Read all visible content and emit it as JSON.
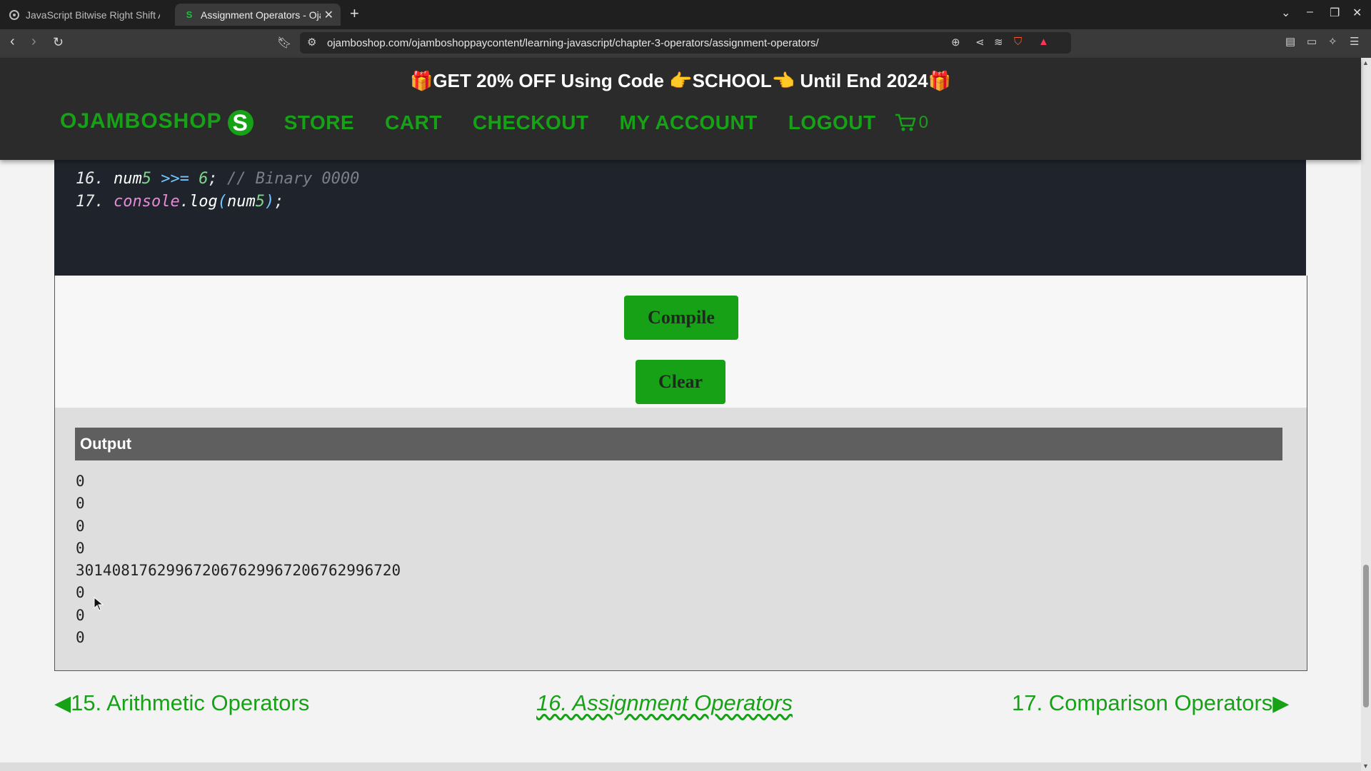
{
  "browser": {
    "tabs": [
      {
        "title": "JavaScript Bitwise Right Shift Assignment",
        "icon": "ojamboshop-favicon"
      },
      {
        "title": "Assignment Operators - Ojambo Shop",
        "icon": "ojamboshop-s-favicon",
        "active": true
      }
    ],
    "url": "ojamboshop.com/ojamboshoppaycontent/learning-javascript/chapter-3-operators/assignment-operators/"
  },
  "header": {
    "promo": "🎁GET 20% OFF Using Code 👉SCHOOL👈 Until End 2024🎁",
    "logo_text": "OJAMBOSHOP",
    "logo_letter": "S",
    "nav": [
      "STORE",
      "CART",
      "CHECKOUT",
      "MY ACCOUNT",
      "LOGOUT"
    ],
    "cart_count": "0"
  },
  "editor": {
    "lines": [
      {
        "num": "16.",
        "tokens": [
          [
            "num",
            "k-var"
          ],
          [
            "5",
            "k-digit"
          ],
          [
            " ",
            ""
          ],
          [
            ">>=",
            "k-op"
          ],
          [
            " ",
            ""
          ],
          [
            "6",
            "k-digit"
          ],
          [
            "; ",
            ""
          ],
          [
            "// Binary 0000",
            "k-comment"
          ]
        ]
      },
      {
        "num": "17.",
        "tokens": [
          [
            "console",
            "k-fn"
          ],
          [
            ".",
            ""
          ],
          [
            "log",
            "k-var"
          ],
          [
            "(",
            "k-op"
          ],
          [
            "num",
            "k-var"
          ],
          [
            "5",
            "k-digit"
          ],
          [
            ")",
            "k-op"
          ],
          [
            ";",
            ""
          ]
        ]
      }
    ]
  },
  "buttons": {
    "compile": "Compile",
    "clear": "Clear"
  },
  "output": {
    "heading": "Output",
    "lines": [
      "0",
      "0",
      "0",
      "0",
      "30140817629967206762996720676299672​0",
      "0",
      "0",
      "0"
    ]
  },
  "pager": {
    "prev": "15. Arithmetic Operators",
    "current": "16. Assignment Operators",
    "next": "17. Comparison Operators"
  },
  "colors": {
    "accent": "#17a117",
    "header_bg": "#2b2b2b",
    "editor_bg": "#1f242c"
  }
}
